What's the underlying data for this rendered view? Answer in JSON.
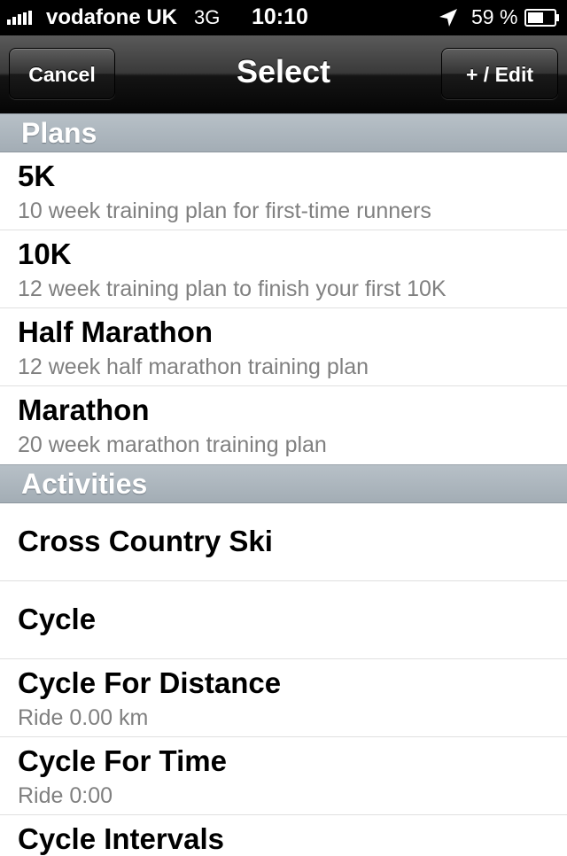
{
  "status_bar": {
    "carrier": "vodafone UK",
    "network": "3G",
    "time": "10:10",
    "battery_percent": "59 %"
  },
  "nav": {
    "title": "Select",
    "cancel_label": "Cancel",
    "edit_label": "+ / Edit"
  },
  "plans": {
    "header": "Plans",
    "items": [
      {
        "title": "5K",
        "subtitle": "10 week training plan for first-time runners"
      },
      {
        "title": "10K",
        "subtitle": "12 week training plan to finish your first 10K"
      },
      {
        "title": "Half Marathon",
        "subtitle": "12 week half marathon training plan"
      },
      {
        "title": "Marathon",
        "subtitle": "20 week marathon training plan"
      }
    ]
  },
  "activities": {
    "header": "Activities",
    "items": [
      {
        "title": "Cross Country Ski"
      },
      {
        "title": "Cycle"
      },
      {
        "title": "Cycle For Distance",
        "subtitle": "Ride 0.00 km"
      },
      {
        "title": "Cycle For Time",
        "subtitle": "Ride 0:00"
      },
      {
        "title": "Cycle Intervals"
      }
    ]
  }
}
